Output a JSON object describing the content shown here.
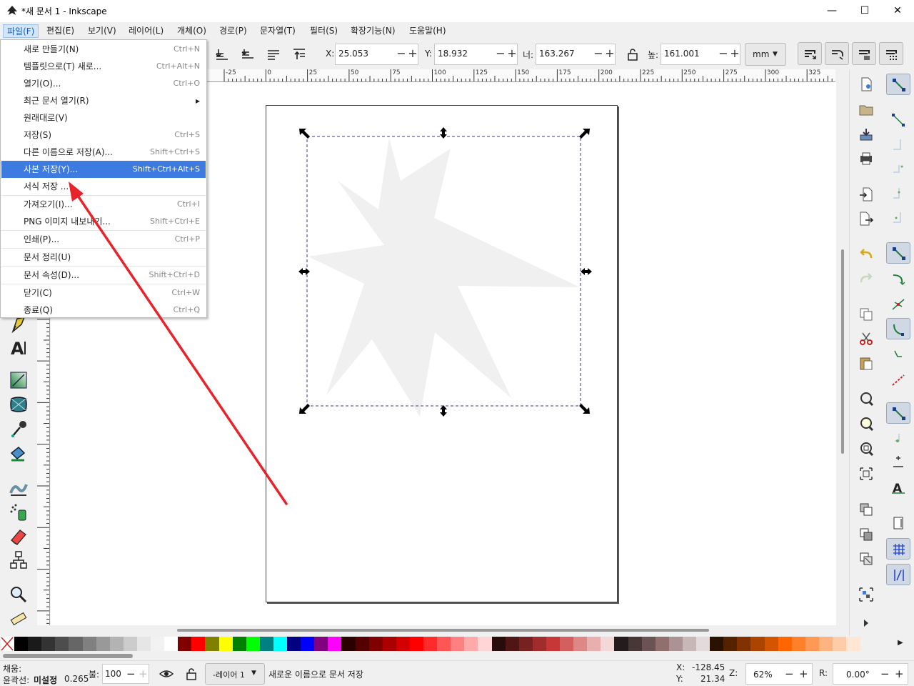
{
  "window": {
    "title": "*새 문서 1 - Inkscape",
    "minimize": "—",
    "maximize": "☐",
    "close": "✕"
  },
  "menubar": [
    {
      "label": "파일(F)"
    },
    {
      "label": "편집(E)"
    },
    {
      "label": "보기(V)"
    },
    {
      "label": "레이어(L)"
    },
    {
      "label": "개체(O)"
    },
    {
      "label": "경로(P)"
    },
    {
      "label": "문자열(T)"
    },
    {
      "label": "필터(S)"
    },
    {
      "label": "확장기능(N)"
    },
    {
      "label": "도움말(H)"
    }
  ],
  "file_menu": [
    {
      "label": "새로 만들기(N)",
      "shortcut": "Ctrl+N"
    },
    {
      "label": "템플릿으로(T) 새로...",
      "shortcut": "Ctrl+Alt+N"
    },
    {
      "label": "열기(O)...",
      "shortcut": "Ctrl+O"
    },
    {
      "label": "최근 문서 열기(R)",
      "shortcut": "▸"
    },
    {
      "label": "원래대로(V)",
      "shortcut": ""
    },
    {
      "label": "저장(S)",
      "shortcut": "Ctrl+S"
    },
    {
      "label": "다른 이름으로 저장(A)...",
      "shortcut": "Shift+Ctrl+S"
    },
    {
      "label": "사본 저장(Y)...",
      "shortcut": "Shift+Ctrl+Alt+S"
    },
    {
      "label": "서식 저장 ...",
      "shortcut": ""
    },
    {
      "label": "가져오기(I)...",
      "shortcut": "Ctrl+I"
    },
    {
      "label": "PNG 이미지 내보내기...",
      "shortcut": "Shift+Ctrl+E"
    },
    {
      "label": "인쇄(P)...",
      "shortcut": "Ctrl+P"
    },
    {
      "label": "문서 정리(U)",
      "shortcut": ""
    },
    {
      "label": "문서 속성(D)...",
      "shortcut": "Shift+Ctrl+D"
    },
    {
      "label": "닫기(C)",
      "shortcut": "Ctrl+W"
    },
    {
      "label": "종료(Q)",
      "shortcut": "Ctrl+Q"
    }
  ],
  "controls": {
    "x_label": "X:",
    "x_value": "25.053",
    "y_label": "Y:",
    "y_value": "18.932",
    "w_label": "너:",
    "w_value": "163.267",
    "h_label": "높:",
    "h_value": "161.001",
    "unit": "mm",
    "minus": "−",
    "plus": "+"
  },
  "ruler_labels": [
    "-25",
    "0",
    "25",
    "50",
    "75",
    "100",
    "125",
    "150",
    "175",
    "200",
    "225",
    "250",
    "275",
    "300",
    "325"
  ],
  "palette_colors": [
    "#000000",
    "#1a1a1a",
    "#333333",
    "#4d4d4d",
    "#666666",
    "#808080",
    "#999999",
    "#b3b3b3",
    "#cccccc",
    "#e6e6e6",
    "#f2f2f2",
    "#ffffff",
    "#800000",
    "#ff0000",
    "#808000",
    "#ffff00",
    "#008000",
    "#00ff00",
    "#008080",
    "#00ffff",
    "#000080",
    "#0000ff",
    "#800080",
    "#ff00ff",
    "#2b0000",
    "#550000",
    "#800000",
    "#aa0000",
    "#d40000",
    "#ff0000",
    "#ff2a2a",
    "#ff5555",
    "#ff8080",
    "#ffaaaa",
    "#ffd5d5",
    "#280b0b",
    "#501616",
    "#782121",
    "#a02c2c",
    "#c83737",
    "#d35f5f",
    "#de8787",
    "#e9afaf",
    "#f4d7d7",
    "#241c1c",
    "#483737",
    "#6c5353",
    "#916f6f",
    "#ac9393",
    "#c8b7b7",
    "#e3dbdb",
    "#2b1100",
    "#552200",
    "#803300",
    "#aa4400",
    "#d45500",
    "#ff6600",
    "#ff7f2a",
    "#ff9955",
    "#ffb380",
    "#ffccaa",
    "#ffe6d5"
  ],
  "status": {
    "fill_label": "채움:",
    "stroke_label": "윤곽선:",
    "stroke_value": "미설정",
    "stroke_width": "0.265",
    "opacity_label": "불:",
    "opacity_value": "100",
    "layer": "-레이어 1",
    "message": "새로운 이름으로 문서 저장",
    "cursor_x_label": "X:",
    "cursor_x": "-128.45",
    "cursor_y_label": "Y:",
    "cursor_y": "21.34",
    "zoom_label": "Z:",
    "zoom": "62%",
    "rotate_label": "R:",
    "rotate": "0.00°"
  },
  "colors": {
    "accent": "#3d7be0",
    "arrow": "#e8232a",
    "star": "#f0f0f0"
  }
}
